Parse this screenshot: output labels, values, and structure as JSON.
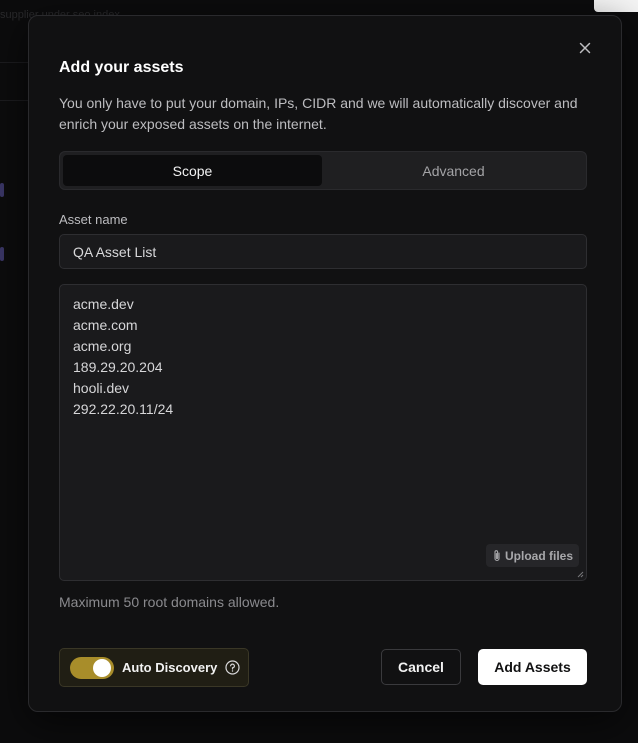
{
  "background": {
    "top_text": "supplier under seo index"
  },
  "modal": {
    "title": "Add your assets",
    "description": "You only have to put your domain, IPs, CIDR and we will automatically discover and enrich your exposed assets on the internet.",
    "close_icon": "close-icon",
    "tabs": [
      {
        "label": "Scope",
        "active": true
      },
      {
        "label": "Advanced",
        "active": false
      }
    ],
    "asset_name": {
      "label": "Asset name",
      "value": "QA Asset List"
    },
    "assets": {
      "lines": [
        "acme.dev",
        "acme.com",
        "acme.org",
        "189.29.20.204",
        "hooli.dev",
        "292.22.20.11/24"
      ],
      "upload_label": "Upload files",
      "upload_icon": "paperclip-icon"
    },
    "hint": "Maximum 50 root domains allowed.",
    "auto_discovery": {
      "label": "Auto Discovery",
      "enabled": true,
      "help_icon": "help-circle-icon"
    },
    "buttons": {
      "cancel": "Cancel",
      "add": "Add Assets"
    }
  },
  "colors": {
    "modal_bg": "#111112",
    "toggle_on": "#a88d2a",
    "primary_button": "#ffffff"
  }
}
